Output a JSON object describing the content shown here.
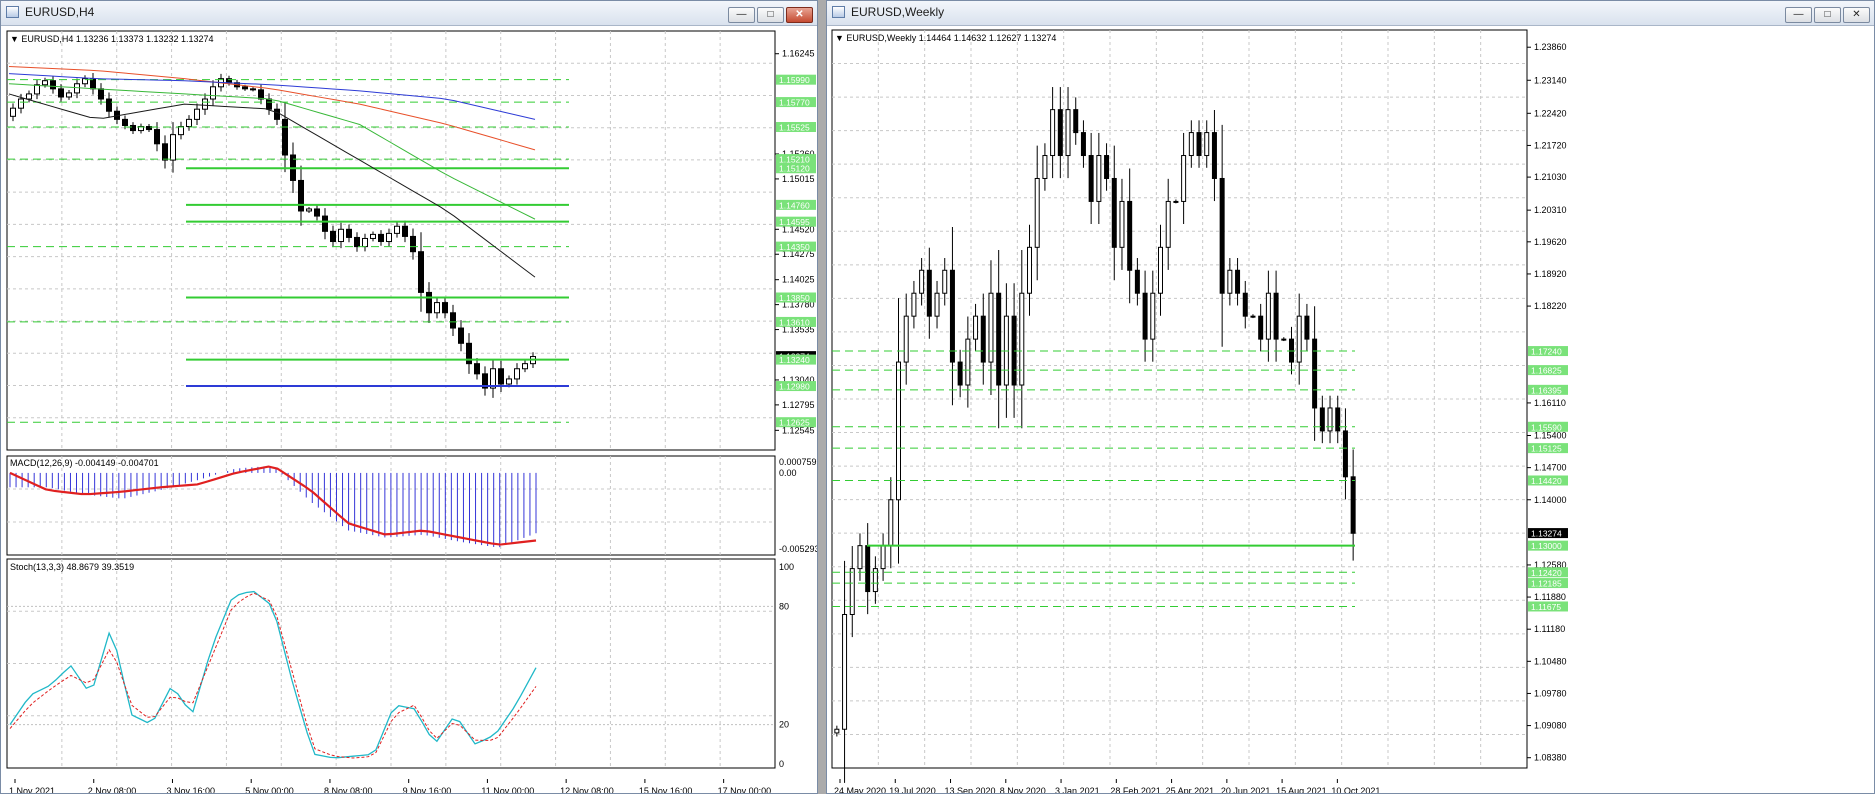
{
  "windows": {
    "h4": {
      "title": "EURUSD,H4",
      "header": "EURUSD,H4  1.13236 1.13373 1.13232 1.13274",
      "price_labels": [
        "1.16245",
        "1.15260",
        "1.15015",
        "1.14520",
        "1.14275",
        "1.14025",
        "1.13780",
        "1.13535",
        "1.13040",
        "1.12795",
        "1.12545"
      ],
      "level_badges": [
        "1.15990",
        "1.15770",
        "1.15525",
        "1.15210",
        "1.15120",
        "1.14760",
        "1.14595",
        "1.14350",
        "1.13850",
        "1.13610",
        "1.13274",
        "1.13240",
        "1.12980",
        "1.12625"
      ],
      "time_labels": [
        "1 Nov 2021",
        "2 Nov 08:00",
        "3 Nov 16:00",
        "5 Nov 00:00",
        "8 Nov 08:00",
        "9 Nov 16:00",
        "11 Nov 00:00",
        "12 Nov 08:00",
        "15 Nov 16:00",
        "17 Nov 00:00"
      ],
      "macd": {
        "header": "MACD(12,26,9) -0.004149 -0.004701",
        "scale": [
          "0.000759",
          "0.00",
          "-0.005293"
        ]
      },
      "stoch": {
        "header": "Stoch(13,3,3) 48.8679 39.3519",
        "scale": [
          "100",
          "80",
          "20",
          "0"
        ]
      }
    },
    "weekly": {
      "title": "EURUSD,Weekly",
      "header": "EURUSD,Weekly  1.14464 1.14632 1.12627 1.13274",
      "price_labels": [
        "1.23860",
        "1.23140",
        "1.22420",
        "1.21720",
        "1.21030",
        "1.20310",
        "1.19620",
        "1.18920",
        "1.18220",
        "1.16110",
        "1.15400",
        "1.14700",
        "1.14000",
        "1.12580",
        "1.11880",
        "1.11180",
        "1.10480",
        "1.09780",
        "1.09080",
        "1.08380"
      ],
      "level_badges": [
        "1.17240",
        "1.16825",
        "1.16395",
        "1.15590",
        "1.15125",
        "1.14420",
        "1.13274",
        "1.13000",
        "1.12420",
        "1.12185",
        "1.11675"
      ],
      "time_labels": [
        "24 May 2020",
        "19 Jul 2020",
        "13 Sep 2020",
        "8 Nov 2020",
        "3 Jan 2021",
        "28 Feb 2021",
        "25 Apr 2021",
        "20 Jun 2021",
        "15 Aug 2021",
        "10 Oct 2021"
      ]
    }
  },
  "colors": {
    "bull": "#ffffff",
    "bear": "#000000",
    "level": "#33cc33",
    "ma_red": "#e8502a",
    "ma_blue": "#2d3bd6",
    "ma_green": "#38b838",
    "macd_hist": "#3535d8",
    "macd_signal": "#e02020",
    "stoch_main": "#20b8c8",
    "stoch_signal": "#e02020",
    "badge": "#7ae27a"
  },
  "chart_data": [
    {
      "type": "candlestick",
      "symbol": "EURUSD",
      "timeframe": "H4",
      "title": "EURUSD,H4",
      "ohlc_last": {
        "open": 1.13236,
        "high": 1.13373,
        "low": 1.13232,
        "close": 1.13274
      },
      "ylim": [
        1.1245,
        1.1637
      ],
      "x_ticks": [
        "1 Nov 2021",
        "2 Nov 08:00",
        "3 Nov 16:00",
        "5 Nov 00:00",
        "8 Nov 08:00",
        "9 Nov 16:00",
        "11 Nov 00:00",
        "12 Nov 08:00",
        "15 Nov 16:00",
        "17 Nov 00:00"
      ],
      "close_path": [
        1.1571,
        1.158,
        1.1585,
        1.1594,
        1.1598,
        1.159,
        1.1582,
        1.1586,
        1.1595,
        1.16,
        1.159,
        1.158,
        1.1568,
        1.156,
        1.1554,
        1.1549,
        1.1553,
        1.155,
        1.1536,
        1.152,
        1.1545,
        1.1553,
        1.156,
        1.157,
        1.158,
        1.1592,
        1.16,
        1.1596,
        1.1592,
        1.159,
        1.1589,
        1.158,
        1.157,
        1.156,
        1.1525,
        1.15,
        1.147,
        1.1472,
        1.1465,
        1.145,
        1.144,
        1.1452,
        1.1444,
        1.1435,
        1.1443,
        1.1447,
        1.144,
        1.1448,
        1.1455,
        1.1445,
        1.143,
        1.139,
        1.137,
        1.138,
        1.137,
        1.1355,
        1.134,
        1.132,
        1.131,
        1.1296,
        1.1315,
        1.13,
        1.1305,
        1.1315,
        1.132,
        1.1327
      ],
      "horizontal_levels": [
        {
          "value": 1.1512,
          "style": "solid",
          "color": "#33cc33"
        },
        {
          "value": 1.1476,
          "style": "solid",
          "color": "#33cc33"
        },
        {
          "value": 1.14595,
          "style": "solid",
          "color": "#33cc33"
        },
        {
          "value": 1.1385,
          "style": "solid",
          "color": "#33cc33"
        },
        {
          "value": 1.1324,
          "style": "solid",
          "color": "#33cc33"
        },
        {
          "value": 1.1298,
          "style": "solid",
          "color": "#2d3bd6"
        },
        {
          "value": 1.1599,
          "style": "dashed"
        },
        {
          "value": 1.1577,
          "style": "dashed"
        },
        {
          "value": 1.15525,
          "style": "dashed"
        },
        {
          "value": 1.1521,
          "style": "dashed"
        },
        {
          "value": 1.1435,
          "style": "dashed"
        },
        {
          "value": 1.1361,
          "style": "dashed"
        },
        {
          "value": 1.12625,
          "style": "dashed"
        }
      ],
      "moving_averages": [
        {
          "color": "#e8502a",
          "values": [
            1.1612,
            1.1608,
            1.16,
            1.159,
            1.1575,
            1.1555,
            1.153
          ]
        },
        {
          "color": "#2d3bd6",
          "values": [
            1.1605,
            1.16,
            1.1598,
            1.1594,
            1.1588,
            1.158,
            1.156
          ]
        },
        {
          "color": "#38b838",
          "values": [
            1.1595,
            1.159,
            1.1585,
            1.158,
            1.1555,
            1.1505,
            1.1462
          ]
        },
        {
          "color": "#1a1a1a",
          "values": [
            1.1585,
            1.156,
            1.1575,
            1.157,
            1.152,
            1.147,
            1.1405
          ]
        }
      ],
      "indicators": {
        "macd": {
          "params": "12,26,9",
          "main": -0.004149,
          "signal": -0.004701,
          "ylim": [
            -0.005293,
            0.000759
          ],
          "signal_path": [
            0.0,
            -0.0012,
            -0.0015,
            -0.0013,
            -0.001,
            -0.0008,
            0.0,
            0.0005,
            -0.0012,
            -0.0035,
            -0.0043,
            -0.004,
            -0.0045,
            -0.005,
            -0.0047
          ],
          "hist_path": [
            -0.001,
            -0.001,
            -0.0015,
            -0.0018,
            -0.0012,
            -0.0005,
            0.0003,
            0.0005,
            -0.002,
            -0.004,
            -0.0045,
            -0.0043,
            -0.0048,
            -0.0052,
            -0.0042
          ]
        },
        "stochastic": {
          "params": "13,3,3",
          "main": 48.8679,
          "signal": 39.3519,
          "ylim": [
            0,
            100
          ],
          "main_path": [
            20,
            35,
            40,
            50,
            35,
            70,
            25,
            20,
            40,
            25,
            60,
            85,
            88,
            80,
            40,
            5,
            3,
            4,
            5,
            30,
            28,
            10,
            25,
            10,
            15,
            30,
            48.9
          ],
          "signal_path": [
            18,
            30,
            38,
            45,
            40,
            60,
            30,
            22,
            35,
            30,
            55,
            80,
            87,
            82,
            45,
            8,
            4,
            3,
            4,
            25,
            30,
            12,
            22,
            12,
            12,
            25,
            39.4
          ]
        }
      }
    },
    {
      "type": "candlestick",
      "symbol": "EURUSD",
      "timeframe": "Weekly",
      "title": "EURUSD,Weekly",
      "ohlc_last": {
        "open": 1.14464,
        "high": 1.14632,
        "low": 1.12627,
        "close": 1.13274
      },
      "ylim": [
        1.0833,
        1.2393
      ],
      "x_ticks": [
        "24 May 2020",
        "19 Jul 2020",
        "13 Sep 2020",
        "8 Nov 2020",
        "3 Jan 2021",
        "28 Feb 2021",
        "25 Apr 2021",
        "20 Jun 2021",
        "15 Aug 2021",
        "10 Oct 2021"
      ],
      "close_path": [
        1.09,
        1.115,
        1.125,
        1.13,
        1.12,
        1.125,
        1.13,
        1.14,
        1.17,
        1.18,
        1.185,
        1.19,
        1.18,
        1.185,
        1.19,
        1.17,
        1.165,
        1.175,
        1.18,
        1.17,
        1.185,
        1.165,
        1.18,
        1.165,
        1.185,
        1.195,
        1.21,
        1.215,
        1.225,
        1.215,
        1.225,
        1.22,
        1.215,
        1.205,
        1.215,
        1.21,
        1.195,
        1.205,
        1.19,
        1.185,
        1.175,
        1.185,
        1.195,
        1.205,
        1.205,
        1.215,
        1.22,
        1.215,
        1.22,
        1.21,
        1.185,
        1.19,
        1.185,
        1.18,
        1.18,
        1.175,
        1.185,
        1.175,
        1.175,
        1.17,
        1.18,
        1.175,
        1.16,
        1.155,
        1.16,
        1.155,
        1.145,
        1.1327
      ],
      "horizontal_levels": [
        {
          "value": 1.13,
          "style": "solid",
          "color": "#33cc33"
        },
        {
          "value": 1.1724,
          "style": "dashed"
        },
        {
          "value": 1.16825,
          "style": "dashed"
        },
        {
          "value": 1.16395,
          "style": "dashed"
        },
        {
          "value": 1.1559,
          "style": "dashed"
        },
        {
          "value": 1.15125,
          "style": "dashed"
        },
        {
          "value": 1.1442,
          "style": "dashed"
        },
        {
          "value": 1.1242,
          "style": "dashed"
        },
        {
          "value": 1.12185,
          "style": "dashed"
        },
        {
          "value": 1.11675,
          "style": "dashed"
        }
      ]
    }
  ]
}
